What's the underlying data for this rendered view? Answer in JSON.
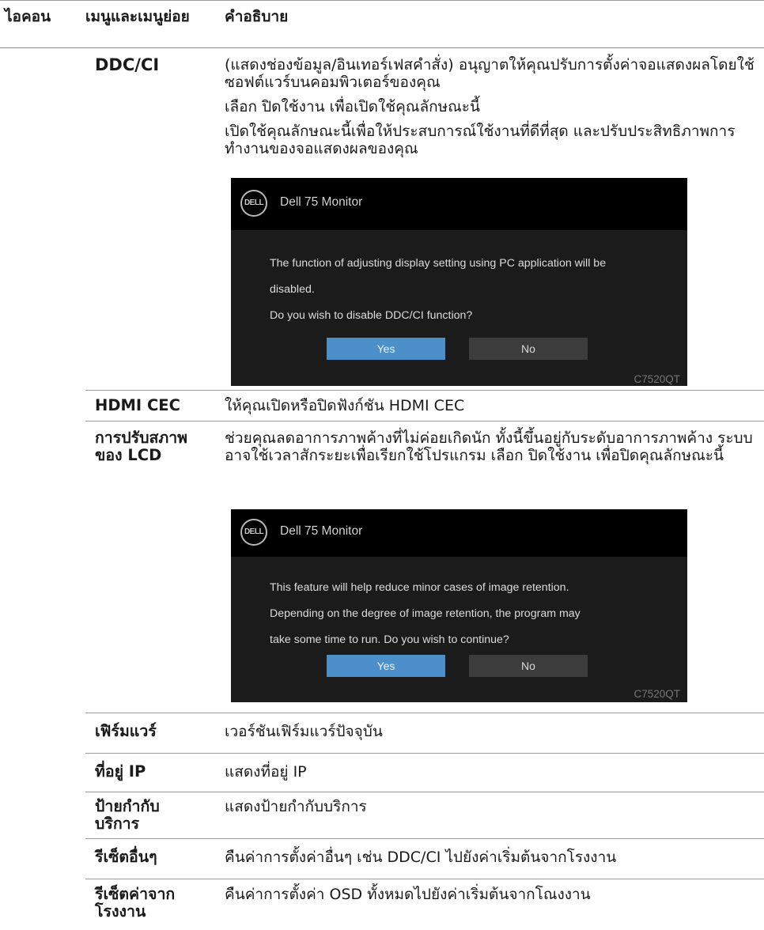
{
  "header": {
    "icon": "ไอคอน",
    "menu": "เมนูและเมนูย่อย",
    "description": "คำอธิบาย"
  },
  "rows": {
    "ddc": {
      "name": "DDC/CI",
      "desc1": " (แสดงช่องข้อมูล/อินเทอร์เฟสคำสั่ง) อนุญาตให้คุณปรับการตั้งค่าจอแสดงผลโดยใช้ซอฟต์แวร์บนคอมพิวเตอร์ของคุณ",
      "desc2": "เลือก ปิดใช้งาน เพื่อเปิดใช้คุณลักษณะนี้",
      "desc3": "เปิดใช้คุณลักษณะนี้เพื่อให้ประสบการณ์ใช้งานที่ดีที่สุด และปรับประสิทธิภาพการทำงานของจอแสดงผลของคุณ",
      "dialog": {
        "logo": "DELL",
        "title": "Dell 75 Monitor",
        "lines": [
          "The function of adjusting display setting using PC application will be",
          "disabled.",
          "Do you wish to disable DDC/CI function?"
        ],
        "yes": "Yes",
        "no": "No",
        "model": "C7520QT"
      }
    },
    "hdmi": {
      "name": "HDMI CEC",
      "desc": "ให้คุณเปิดหรือปิดฟังก์ชัน HDMI CEC"
    },
    "lcd": {
      "name": "การปรับสภาพของ LCD",
      "desc": "ช่วยคุณลดอาการภาพค้างที่ไม่ค่อยเกิดนัก ทั้งนี้ขึ้นอยู่กับระดับอาการภาพค้าง ระบบอาจใช้เวลาสักระยะเพื่อเรียกใช้โปรแกรม เลือก ปิดใช้งาน  เพื่อปิดคุณลักษณะนี้",
      "dialog": {
        "logo": "DELL",
        "title": "Dell 75 Monitor",
        "lines": [
          "This feature will help reduce minor cases of image retention.",
          "Depending on the degree of image retention, the program may",
          "take some time to run. Do you wish to continue?"
        ],
        "yes": "Yes",
        "no": "No",
        "model": "C7520QT"
      }
    },
    "firmware": {
      "name": "เฟิร์มแวร์",
      "desc": "เวอร์ชันเฟิร์มแวร์ปัจจุบัน"
    },
    "ip": {
      "name": "ที่อยู่ IP",
      "desc": "แสดงที่อยู่ IP"
    },
    "tag": {
      "name": "ป้ายกำกับบริการ",
      "desc": "แสดงป้ายกำกับบริการ"
    },
    "other_reset": {
      "name": "รีเซ็ตอื่นๆ",
      "desc": "คืนค่าการตั้งค่าอื่นๆ เช่น DDC/CI ไปยังค่าเริ่มต้นจากโรงงาน"
    },
    "factory_reset": {
      "name": "รีเซ็ตค่าจากโรงงาน",
      "desc": "คืนค่าการตั้งค่า OSD ทั้งหมดไปยังค่าเริ่มต้นจากโณงงาน"
    }
  }
}
